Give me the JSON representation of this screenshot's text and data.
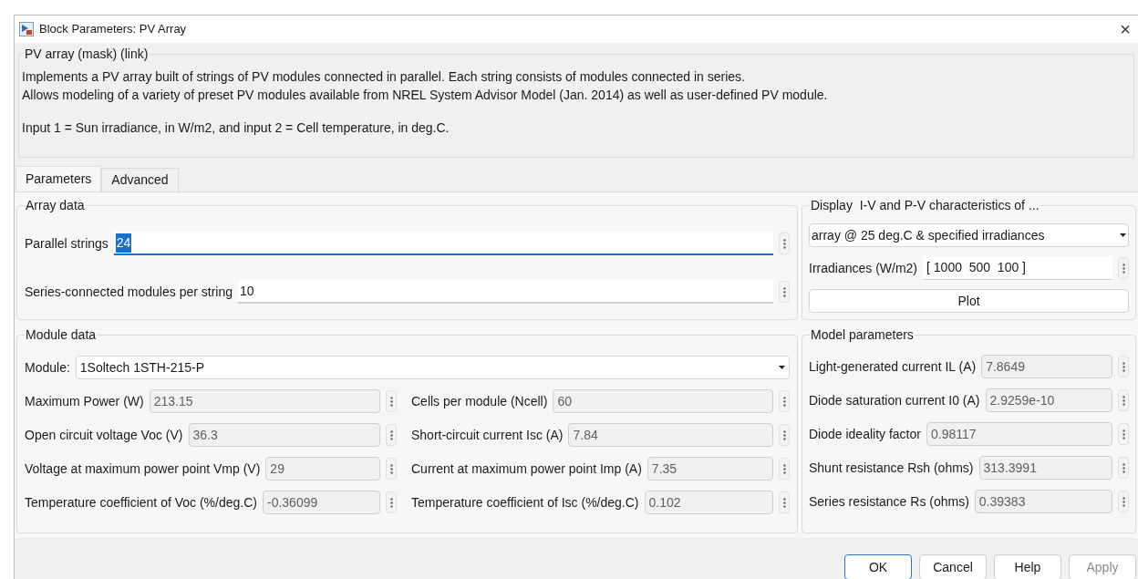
{
  "window": {
    "title": "Block Parameters: PV Array",
    "close": "×"
  },
  "mask": {
    "title": "PV array (mask) (link)",
    "lines": [
      "Implements a PV array built of strings of PV modules connected in parallel. Each string consists of modules connected in series.",
      "Allows modeling of a variety of preset PV modules available from NREL System Advisor Model (Jan. 2014) as well as user-defined PV module.",
      "Input 1 = Sun irradiance, in W/m2, and input 2 = Cell temperature, in deg.C."
    ]
  },
  "tabs": [
    {
      "label": "Parameters",
      "selected": true
    },
    {
      "label": "Advanced",
      "selected": false
    }
  ],
  "array_data": {
    "title": "Array data",
    "fields": [
      {
        "label": "Parallel strings",
        "value": "24",
        "focused": true
      },
      {
        "label": "Series-connected modules per string",
        "value": "10",
        "focused": false
      }
    ]
  },
  "display": {
    "title": "Display  I-V and P-V characteristics of ...",
    "dropdown": "array @ 25 deg.C & specified irradiances",
    "irradiance": {
      "label": "Irradiances (W/m2)",
      "value": "[ 1000  500  100 ]"
    },
    "plot": "Plot"
  },
  "module_data": {
    "title": "Module data",
    "module": {
      "label": "Module:",
      "value": "1Soltech 1STH-215-P"
    },
    "rows": [
      [
        {
          "label": "Maximum Power (W)",
          "value": "213.15",
          "disabled": true
        },
        {
          "label": "Cells per module (Ncell)",
          "value": "60",
          "disabled": true
        }
      ],
      [
        {
          "label": "Open circuit voltage  Voc (V)",
          "value": "36.3",
          "disabled": true
        },
        {
          "label": "Short-circuit current Isc (A)",
          "value": "7.84",
          "disabled": true
        }
      ],
      [
        {
          "label": "Voltage at maximum power point Vmp (V)",
          "value": "29",
          "disabled": true
        },
        {
          "label": "Current at maximum power point Imp (A)",
          "value": "7.35",
          "disabled": true
        }
      ],
      [
        {
          "label": "Temperature coefficient of Voc (%/deg.C)",
          "value": "-0.36099",
          "disabled": true
        },
        {
          "label": "Temperature coefficient of Isc (%/deg.C)",
          "value": "0.102",
          "disabled": true
        }
      ]
    ]
  },
  "model_parameters": {
    "title": "Model parameters",
    "fields": [
      {
        "label": "Light-generated current IL (A)",
        "value": "7.8649",
        "disabled": true
      },
      {
        "label": "Diode saturation current I0 (A)",
        "value": "2.9259e-10",
        "disabled": true
      },
      {
        "label": "Diode ideality factor",
        "value": "0.98117",
        "disabled": true
      },
      {
        "label": "Shunt resistance Rsh (ohms)",
        "value": "313.3991",
        "disabled": true
      },
      {
        "label": "Series resistance Rs (ohms)",
        "value": "0.39383",
        "disabled": true
      }
    ]
  },
  "buttons": [
    {
      "label": "OK",
      "default": true,
      "disabled": false
    },
    {
      "label": "Cancel",
      "default": false,
      "disabled": false
    },
    {
      "label": "Help",
      "default": false,
      "disabled": false
    },
    {
      "label": "Apply",
      "default": false,
      "disabled": true
    }
  ]
}
